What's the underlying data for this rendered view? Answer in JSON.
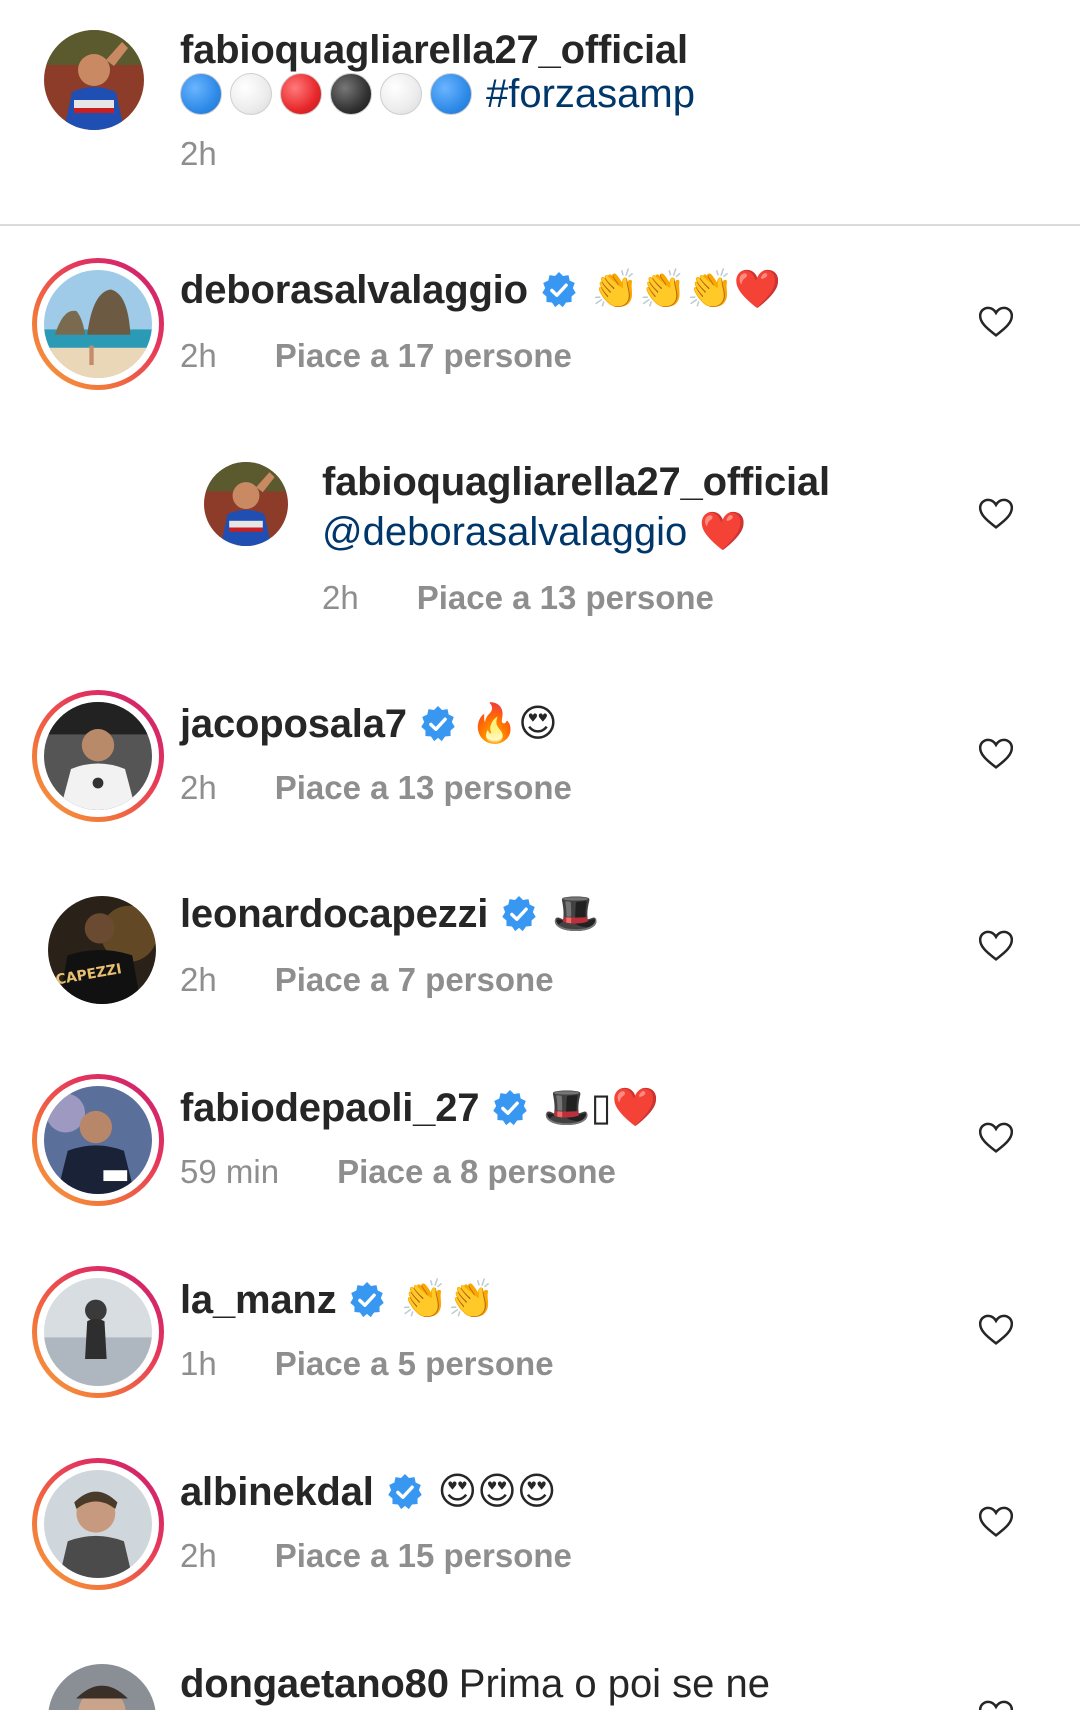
{
  "caption": {
    "username": "fabioquagliarella27_official",
    "dot_colors": [
      "#2f8be8",
      "#f2f2f2",
      "#e8282b",
      "#333333",
      "#f2f2f2",
      "#2f8be8"
    ],
    "hashtag": "#forzasamp",
    "time": "2h"
  },
  "comments": [
    {
      "username": "deborasalvalaggio",
      "verified": true,
      "emoji": "👏👏👏❤️",
      "time": "2h",
      "likes": "Piace a 17 persone",
      "icon": "heart-outline-icon"
    },
    {
      "username": "fabioquagliarella27_official",
      "mention": "@deborasalvalaggio",
      "emoji": "❤️",
      "time": "2h",
      "likes": "Piace a 13 persone",
      "icon": "heart-outline-icon"
    },
    {
      "username": "jacoposala7",
      "verified": true,
      "emoji": "🔥😍",
      "time": "2h",
      "likes": "Piace a 13 persone",
      "icon": "heart-outline-icon"
    },
    {
      "username": "leonardocapezzi",
      "verified": true,
      "emoji": "🎩",
      "time": "2h",
      "likes": "Piace a 7 persone",
      "icon": "heart-outline-icon"
    },
    {
      "username": "fabiodepaoli_27",
      "verified": true,
      "emoji": "🎩▯❤️",
      "time": "59 min",
      "likes": "Piace a 8 persone",
      "icon": "heart-outline-icon"
    },
    {
      "username": "la_manz",
      "verified": true,
      "emoji": "👏👏",
      "time": "1h",
      "likes": "Piace a 5 persone",
      "icon": "heart-outline-icon"
    },
    {
      "username": "albinekdal",
      "verified": true,
      "emoji": "😍😍😍",
      "time": "2h",
      "likes": "Piace a 15 persone",
      "icon": "heart-outline-icon"
    },
    {
      "username": "dongaetano80",
      "text": "Prima o poi se ne",
      "icon": "heart-outline-icon"
    }
  ]
}
